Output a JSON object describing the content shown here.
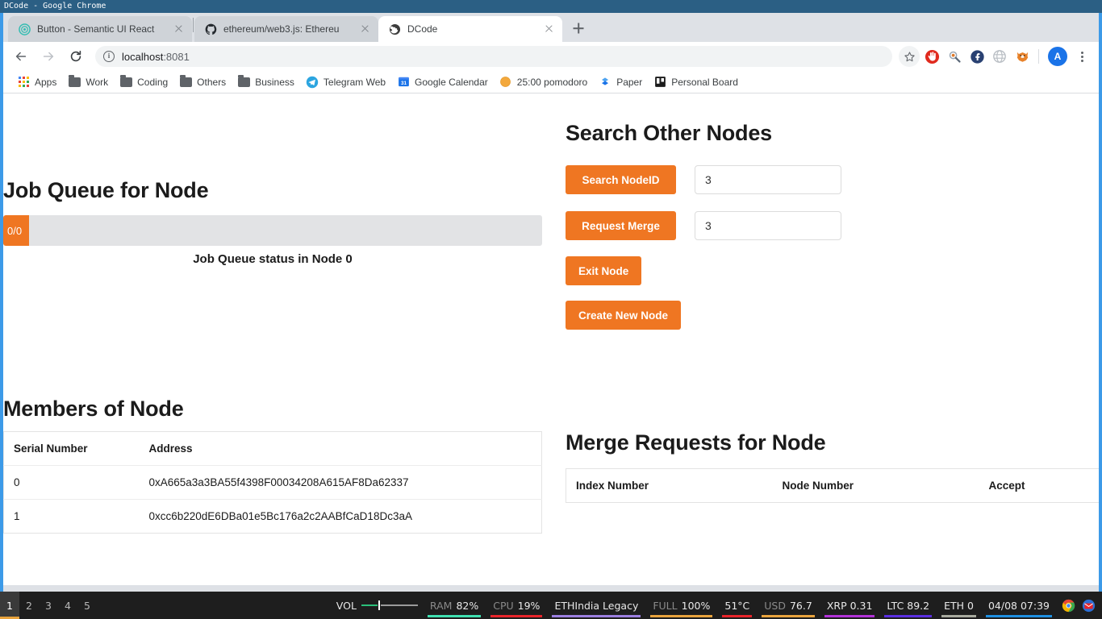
{
  "window": {
    "wm_title": "DCode - Google Chrome"
  },
  "browser": {
    "tabs": [
      {
        "title": "Button - Semantic UI React",
        "favicon": "semantic-ui-icon",
        "active": false
      },
      {
        "title": "ethereum/web3.js: Ethereu",
        "favicon": "github-icon",
        "active": false
      },
      {
        "title": "DCode",
        "favicon": "globe-icon",
        "active": true
      }
    ],
    "new_tab_label": "+",
    "nav": {
      "back": "←",
      "forward": "→",
      "reload": "↻"
    },
    "omnibox": {
      "info_icon": "info-icon",
      "host": "localhost",
      "port": ":8081"
    },
    "toolbar_icons": [
      {
        "name": "bookmark-star-icon",
        "glyph": "☆"
      },
      {
        "name": "adblock-extension-icon",
        "glyph": "✋"
      },
      {
        "name": "metamask-extension-icon",
        "glyph": "🦊"
      },
      {
        "name": "fedora-extension-icon",
        "glyph": "f"
      },
      {
        "name": "globe-extension-icon",
        "glyph": "♁"
      },
      {
        "name": "fox-extension-icon",
        "glyph": "🦊"
      }
    ],
    "avatar_letter": "A",
    "bookmarks": [
      {
        "label": "Apps",
        "icon": "apps-grid-icon"
      },
      {
        "label": "Work",
        "icon": "folder-icon"
      },
      {
        "label": "Coding",
        "icon": "folder-icon"
      },
      {
        "label": "Others",
        "icon": "folder-icon"
      },
      {
        "label": "Business",
        "icon": "folder-icon"
      },
      {
        "label": "Telegram Web",
        "icon": "telegram-icon"
      },
      {
        "label": "Google Calendar",
        "icon": "google-calendar-icon"
      },
      {
        "label": "25:00 pomodoro",
        "icon": "pomodoro-icon"
      },
      {
        "label": "Paper",
        "icon": "dropbox-paper-icon"
      },
      {
        "label": "Personal Board",
        "icon": "personal-board-icon"
      }
    ]
  },
  "page": {
    "job_queue": {
      "title": "Job Queue for Node",
      "progress_label": "0/0",
      "progress_percent": 4.8,
      "caption": "Job Queue status in Node 0"
    },
    "search_nodes": {
      "title": "Search Other Nodes",
      "search_button": "Search NodeID",
      "search_value": "3",
      "merge_button": "Request Merge",
      "merge_value": "3",
      "exit_button": "Exit Node",
      "create_button": "Create New Node"
    },
    "members": {
      "title": "Members of Node",
      "columns": [
        "Serial Number",
        "Address"
      ],
      "rows": [
        {
          "serial": "0",
          "address": "0xA665a3a3BA55f4398F00034208A615AF8Da62337"
        },
        {
          "serial": "1",
          "address": "0xcc6b220dE6DBa01e5Bc176a2c2AABfCaD18Dc3aA"
        }
      ]
    },
    "merge_requests": {
      "title": "Merge Requests for Node",
      "columns": [
        "Index Number",
        "Node Number",
        "Accept"
      ],
      "rows": []
    },
    "accent_color": "#ef7622"
  },
  "taskbar": {
    "workspaces": [
      "1",
      "2",
      "3",
      "4",
      "5"
    ],
    "active_workspace": "1",
    "volume_label": "VOL",
    "segments": [
      {
        "label": "RAM",
        "value": "82%",
        "color": "#3fe0b0"
      },
      {
        "label": "CPU",
        "value": "19%",
        "color": "#e8242a"
      },
      {
        "label": "",
        "value": "ETHIndia Legacy",
        "color": "#9c7fe0"
      },
      {
        "label": "FULL",
        "value": "100%",
        "color": "#e8a33d"
      },
      {
        "label": "",
        "value": "51°C",
        "color": "#e8242a"
      },
      {
        "label": "USD",
        "value": "76.7",
        "color": "#e8a33d"
      },
      {
        "label": "",
        "value": "XRP 0.31",
        "color": "#b232d8"
      },
      {
        "label": "",
        "value": "LTC 89.2",
        "color": "#5a2ee0"
      },
      {
        "label": "",
        "value": "ETH 0",
        "color": "#a8aa9e"
      },
      {
        "label": "",
        "value": "04/08 07:39",
        "color": "#1e8fe0"
      }
    ],
    "tray": [
      {
        "name": "chrome-tray-icon",
        "color": "#f4b400"
      },
      {
        "name": "mail-tray-icon",
        "color": "#e8242a"
      }
    ]
  }
}
